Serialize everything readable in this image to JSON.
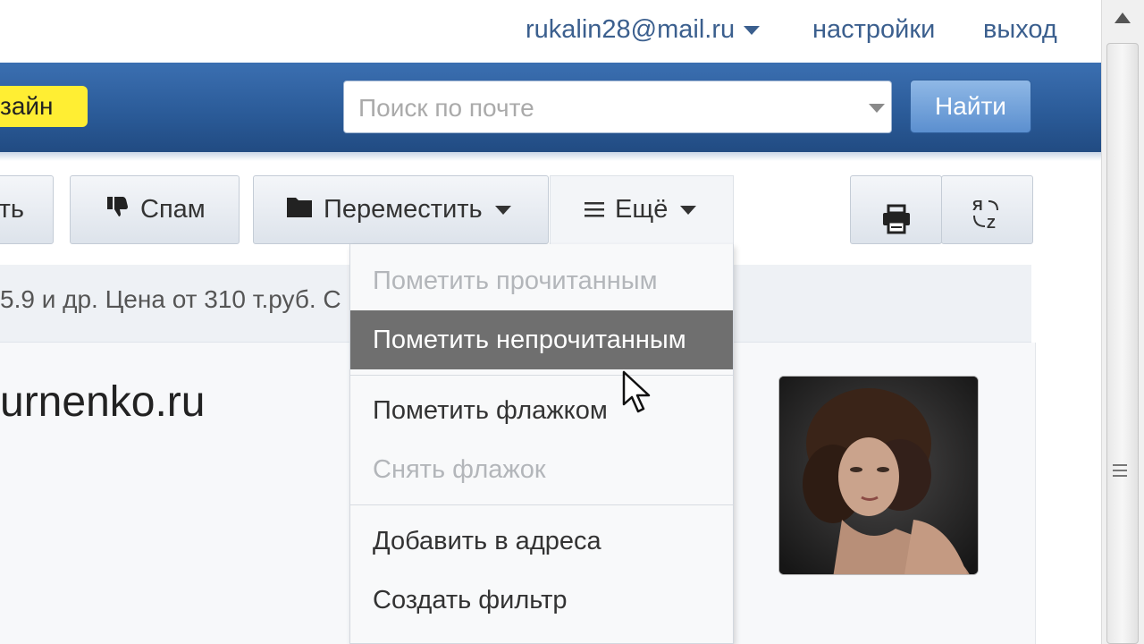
{
  "top": {
    "account": "rukalin28@mail.ru",
    "settings": "настройки",
    "logout": "выход"
  },
  "header": {
    "design_label": "зайн",
    "search_placeholder": "Поиск по почте",
    "find_label": "Найти"
  },
  "toolbar": {
    "delete_label": "ть",
    "spam_label": "Спам",
    "move_label": "Переместить",
    "more_label": "Ещё",
    "print_icon": "printer-icon",
    "translit_icon": "translit-icon"
  },
  "message": {
    "snippet": "5.9 и др. Цена от 310 т.руб. С",
    "sender": "urnenko.ru"
  },
  "menu": {
    "items": [
      {
        "label": "Пометить прочитанным",
        "state": "disabled"
      },
      {
        "label": "Пометить непрочитанным",
        "state": "active"
      },
      {
        "label": "Пометить флажком",
        "state": "enabled"
      },
      {
        "label": "Снять флажок",
        "state": "disabled"
      },
      {
        "label": "Добавить в адреса",
        "state": "enabled"
      },
      {
        "label": "Создать фильтр",
        "state": "enabled"
      }
    ]
  },
  "colors": {
    "header_blue": "#2a5a97",
    "design_yellow": "#ffee33",
    "link_blue": "#3b5f8e",
    "menu_active": "#6f6f6f"
  }
}
